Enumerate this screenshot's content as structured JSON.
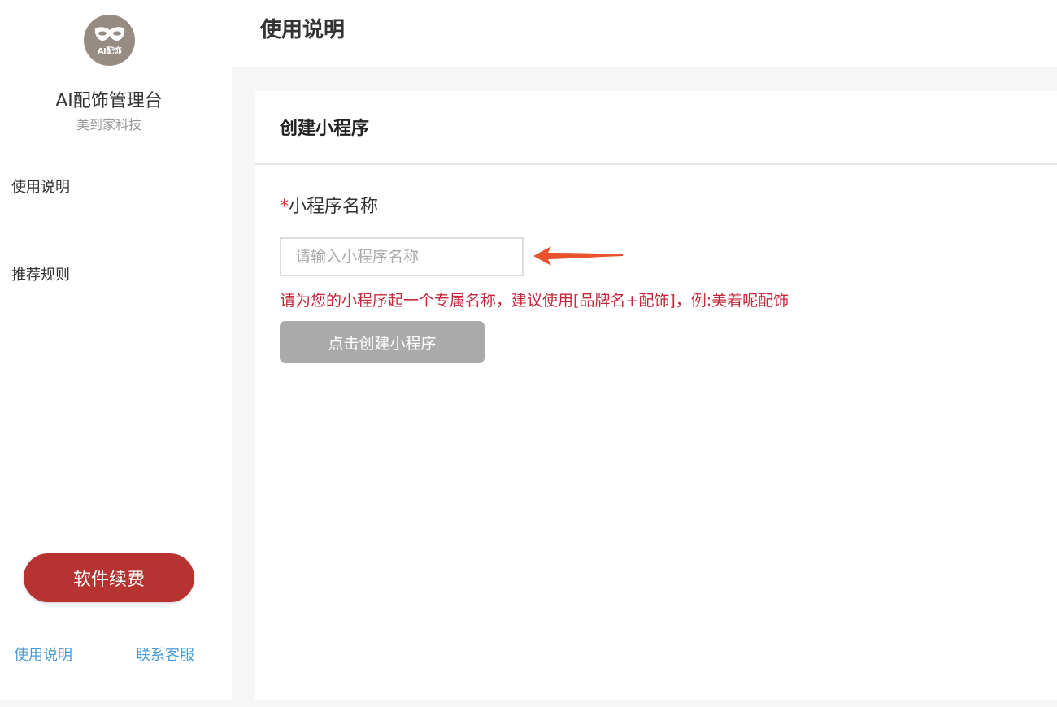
{
  "sidebar": {
    "logo_text": "AI配饰",
    "app_name": "AI配饰管理台",
    "company": "美到家科技",
    "nav": [
      {
        "label": "使用说明"
      },
      {
        "label": "推荐规则"
      }
    ],
    "renew_label": "软件续费",
    "footer": {
      "guide_label": "使用说明",
      "contact_label": "联系客服"
    }
  },
  "header": {
    "title": "使用说明"
  },
  "card": {
    "title": "创建小程序",
    "field": {
      "required_mark": "*",
      "label": "小程序名称",
      "placeholder": "请输入小程序名称",
      "value": ""
    },
    "hint": "请为您的小程序起一个专属名称，建议使用[品牌名+配饰]，例:美着呢配饰",
    "create_label": "点击创建小程序"
  },
  "colors": {
    "accent_red": "#b73331",
    "hint_red": "#c4283a",
    "link_blue": "#4a9ad4",
    "disabled_gray": "#aaaaaa",
    "arrow_orange": "#e8532e"
  },
  "icons": {
    "logo": "mask-icon",
    "pointer": "arrow-left-icon"
  }
}
